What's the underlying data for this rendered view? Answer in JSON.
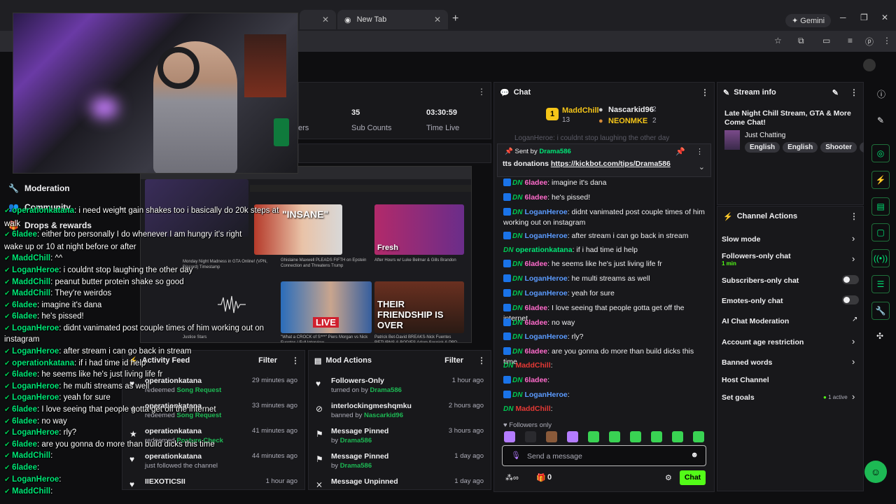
{
  "browser": {
    "tab2_title": "New Tab",
    "gemini_label": "Gemini"
  },
  "stats": [
    {
      "value": "",
      "label": "ers"
    },
    {
      "value": "35",
      "label": "Sub Counts"
    },
    {
      "value": "03:30:59",
      "label": "Time Live"
    }
  ],
  "nav": {
    "moderation": "Moderation",
    "community": "Community",
    "drops": "Drops & rewards"
  },
  "overlay_chat": [
    {
      "user": "operationkatana",
      "text": ": i need weight gain shakes too i basically do 20k steps at",
      "color": "#00e676"
    },
    {
      "user": "6ladee",
      "text": ": either bro personally I do whenever I am hungry it's right",
      "color": "#00e676"
    },
    {
      "user": "MaddChill",
      "text": ": ^^",
      "color": "#00e676"
    },
    {
      "user": "LoganHeroe",
      "text": ": i couldnt stop laughing the other day",
      "color": "#00e676"
    },
    {
      "user": "MaddChill",
      "text": ": peanut butter protein shake so good",
      "color": "#00e676"
    },
    {
      "user": "MaddChill",
      "text": ": They're weirdos",
      "color": "#00e676"
    },
    {
      "user": "6ladee",
      "text": ": imagine it's dana",
      "color": "#00e676"
    },
    {
      "user": "6ladee",
      "text": ": he's pissed!",
      "color": "#00e676"
    },
    {
      "user": "LoganHeroe",
      "text": ": didnt vanimated post couple times of him working out on",
      "color": "#00e676"
    },
    {
      "user": "LoganHeroe",
      "text": ": after stream i can go back in stream",
      "color": "#00e676"
    },
    {
      "user": "operationkatana",
      "text": ": if i had time id help",
      "color": "#00e676"
    },
    {
      "user": "6ladee",
      "text": ": he seems like he's just living life fr",
      "color": "#00e676"
    },
    {
      "user": "LoganHeroe",
      "text": ": he multi streams as well",
      "color": "#00e676"
    },
    {
      "user": "LoganHeroe",
      "text": ": yeah for sure",
      "color": "#00e676"
    },
    {
      "user": "6ladee",
      "text": ": I love seeing that people gotta get off the internet",
      "color": "#00e676"
    },
    {
      "user": "6ladee",
      "text": ": no way",
      "color": "#00e676"
    },
    {
      "user": "LoganHeroe",
      "text": ": rly?",
      "color": "#00e676"
    },
    {
      "user": "6ladee",
      "text": ": are you gonna do more than build dicks this time",
      "color": "#00e676"
    },
    {
      "user": "MaddChill",
      "text": ":",
      "color": "#00e676"
    },
    {
      "user": "6ladee",
      "text": ":",
      "color": "#00e676"
    },
    {
      "user": "LoganHeroe",
      "text": ":",
      "color": "#00e676"
    },
    {
      "user": "MaddChill",
      "text": ":",
      "color": "#00e676"
    }
  ],
  "overlay_wrap": {
    "wake": "wake up or 10 at night before or after",
    "walk": "walk",
    "instagram": "instagram"
  },
  "preview": {
    "thumb1": "\"INSANE\"",
    "thumb2_title": "Fresh",
    "thumb3_live": "LIVE",
    "thumb4": "THEIR FRIENDSHIP IS OVER",
    "cap1": "Monday Night Madness in GTA Online! (VPN, Discord) Timestamp",
    "cap2": "Ghislaine Maxwell PLEADS FIFTH on Epstein Connection and Threatens Trump",
    "cap3": "After Hours w/ Luke Belmar & Gills Brandon",
    "cap4": "\"What a CROCK of S***\" Piers Morgan vs Nick Fuentes | Full Interview",
    "cap5": "Patrick Bet-David BREAKS-Nick Fuentes RETURNS & BODIES Adam Sosnick & PBD Podcast",
    "cap6": "Justice Stars"
  },
  "activity": {
    "title": "Activity Feed",
    "filter": "Filter",
    "rows": [
      {
        "name": "operationkatana",
        "sub": "redeemed",
        "reward": "Song Request",
        "time": "29 minutes ago",
        "icon": "♥"
      },
      {
        "name": "operationkatana",
        "sub": "redeemed",
        "reward": "Song Request",
        "time": "33 minutes ago",
        "icon": "★"
      },
      {
        "name": "operationkatana",
        "sub": "redeemed",
        "reward": "Posture Check",
        "time": "41 minutes ago",
        "icon": "★"
      },
      {
        "name": "operationkatana",
        "sub": "just followed the channel",
        "reward": "",
        "time": "44 minutes ago",
        "icon": "♥"
      },
      {
        "name": "IIEXOTICSII",
        "sub": "",
        "reward": "",
        "time": "1 hour ago",
        "icon": "♥"
      }
    ]
  },
  "mod": {
    "title": "Mod Actions",
    "filter": "Filter",
    "rows": [
      {
        "name": "Followers-Only",
        "sub": "turned on by",
        "by": "Drama586",
        "time": "1 hour ago",
        "icon": "♥"
      },
      {
        "name": "interlockingmeshqmku",
        "sub": "banned by",
        "by": "Nascarkid96",
        "time": "2 hours ago",
        "icon": "⊘"
      },
      {
        "name": "Message Pinned",
        "sub": "by",
        "by": "Drama586",
        "time": "3 hours ago",
        "icon": "⚑"
      },
      {
        "name": "Message Pinned",
        "sub": "by",
        "by": "Drama586",
        "time": "1 day ago",
        "icon": "⚑"
      },
      {
        "name": "Message Unpinned",
        "sub": "",
        "by": "",
        "time": "1 day ago",
        "icon": "⨯"
      }
    ]
  },
  "chat": {
    "title": "Chat",
    "leader1_name": "MaddChill",
    "leader1_count": "13",
    "leader2_name": "Nascarkid96",
    "leader2_count": "2",
    "leader3_name": "NEONMKE",
    "leader3_count": "2",
    "pinned_by_label": "Sent by",
    "pinned_by": "Drama586",
    "pinned_text_prefix": "tts donations ",
    "pinned_link": "https://kickbot.com/tips/Drama586",
    "faded_top": "LoganHeroe: i couldnt stop laughing the other day",
    "messages": [
      {
        "user": "6ladee",
        "text": ": imagine it's dana",
        "color": "#ff6bcb",
        "badge": "b"
      },
      {
        "user": "6ladee",
        "text": ": he's pissed!",
        "color": "#ff6bcb",
        "badge": "b"
      },
      {
        "user": "LoganHeroe",
        "text": ": didnt vanimated post couple times of him working out on instagram",
        "color": "#5b9bff",
        "badge": "b"
      },
      {
        "user": "LoganHeroe",
        "text": ": after stream i can go back in stream",
        "color": "#5b9bff",
        "badge": "b"
      },
      {
        "user": "operationkatana",
        "text": ": if i had time id help",
        "color": "#00e676",
        "badge": "d"
      },
      {
        "user": "6ladee",
        "text": ": he seems like he's just living life fr",
        "color": "#ff6bcb",
        "badge": "b"
      },
      {
        "user": "LoganHeroe",
        "text": ": he multi streams as well",
        "color": "#5b9bff",
        "badge": "b"
      },
      {
        "user": "LoganHeroe",
        "text": ": yeah for sure",
        "color": "#5b9bff",
        "badge": "b"
      },
      {
        "user": "6ladee",
        "text": ": I love seeing that people gotta get off the internet",
        "color": "#ff6bcb",
        "badge": "b"
      },
      {
        "user": "6ladee",
        "text": ": no way",
        "color": "#ff6bcb",
        "badge": "b"
      },
      {
        "user": "LoganHeroe",
        "text": ": rly?",
        "color": "#5b9bff",
        "badge": "b"
      },
      {
        "user": "6ladee",
        "text": ": are you gonna do more than build dicks this time",
        "color": "#ff6bcb",
        "badge": "b"
      },
      {
        "user": "MaddChill",
        "text": ":",
        "color": "#e53935",
        "badge": "d"
      },
      {
        "user": "6ladee",
        "text": ":",
        "color": "#ff6bcb",
        "badge": "b"
      },
      {
        "user": "LoganHeroe",
        "text": ":",
        "color": "#5b9bff",
        "badge": "b"
      },
      {
        "user": "MaddChill",
        "text": ":",
        "color": "#e53935",
        "badge": "d"
      }
    ],
    "followers_only": "Followers only",
    "input_placeholder": "Send a message",
    "points": "0",
    "chat_button": "Chat"
  },
  "stream_info": {
    "title": "Stream info",
    "stream_title": "Late Night Chill Stream, GTA & More Come Chat!",
    "category": "Just Chatting",
    "tags": [
      "English",
      "English",
      "Shooter",
      "ch"
    ]
  },
  "channel_actions": {
    "title": "Channel Actions",
    "slow_mode": "Slow mode",
    "followers_only": "Followers-only chat",
    "followers_only_sub": "1 min",
    "subscribers_only": "Subscribers-only chat",
    "emotes_only": "Emotes-only chat",
    "ai_mod": "AI Chat Moderation",
    "account_age": "Account age restriction",
    "banned_words": "Banned words",
    "host": "Host Channel",
    "goals": "Set goals",
    "goals_active": "1 active"
  },
  "colors": {
    "accent": "#53fc18",
    "bg": "#0e0e10",
    "panel": "#18181b"
  }
}
